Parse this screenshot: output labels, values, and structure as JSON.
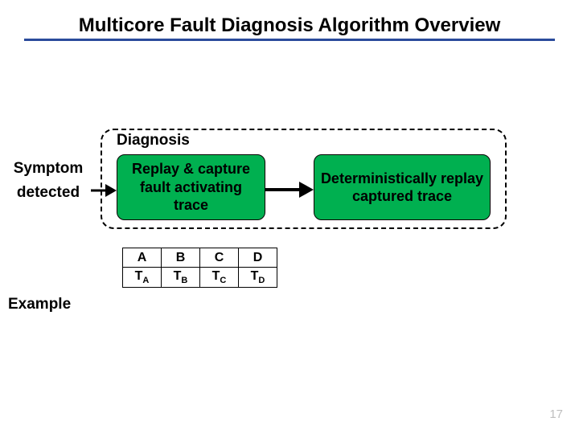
{
  "title": "Multicore Fault Diagnosis Algorithm Overview",
  "symptom": {
    "line1": "Symptom",
    "line2": "detected"
  },
  "diagnosis": {
    "label": "Diagnosis",
    "box1": "Replay & capture fault activating trace",
    "box2": "Deterministically replay captured trace"
  },
  "table": {
    "headers": [
      "A",
      "B",
      "C",
      "D"
    ],
    "rows": [
      {
        "prefix": "T",
        "sub": "A"
      },
      {
        "prefix": "T",
        "sub": "B"
      },
      {
        "prefix": "T",
        "sub": "C"
      },
      {
        "prefix": "T",
        "sub": "D"
      }
    ]
  },
  "example": "Example",
  "page": "17",
  "colors": {
    "accent": "#00b050",
    "underline": "#2a4b9b"
  }
}
